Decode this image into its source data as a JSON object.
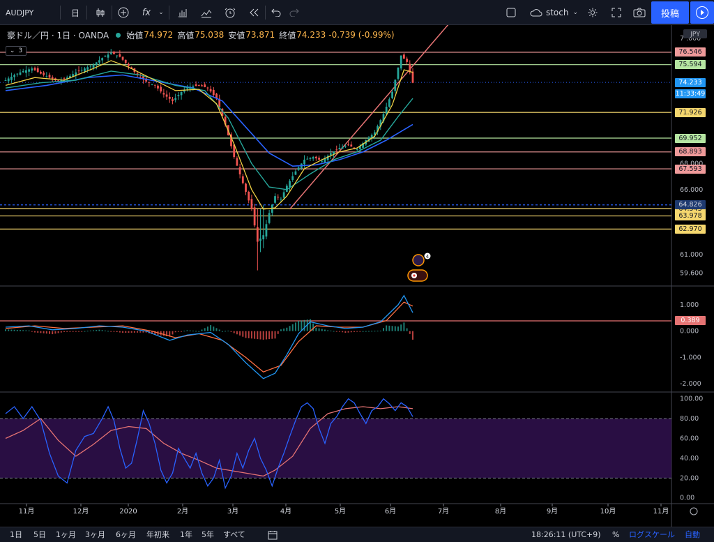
{
  "toolbar": {
    "symbol": "AUDJPY",
    "interval": "日",
    "indicator": "stoch",
    "publish": "投稿",
    "fx_label": "fx"
  },
  "legend": {
    "title": "豪ドル／円 · 1日 · OANDA",
    "open_label": "始値",
    "open": "74.972",
    "high_label": "高値",
    "high": "75.038",
    "low_label": "安値",
    "low": "73.871",
    "close_label": "終値",
    "close": "74.233",
    "change": "-0.739 (-0.99%)",
    "collapse_count": "3"
  },
  "currency": "JPY",
  "colors": {
    "sma_fast": "#f0d044",
    "sma_mid": "#26a69a",
    "sma_slow": "#2962ff",
    "resistance": "#ef9a9a",
    "support_yellow": "#f5d76e",
    "support_green": "#b5e5a1",
    "trendline": "#e57373",
    "stoch_k": "#2962ff",
    "stoch_d": "#e57373",
    "stoch_band": "#2e0f4a",
    "candle_up": "#26a69a",
    "candle_down": "#ef5350",
    "macd_line": "#2196f3",
    "signal_line": "#ff7043"
  },
  "chart_data": {
    "type": "candlestick",
    "ylim": [
      58.6,
      78.2
    ],
    "price_ticks": [
      "61.000",
      "59.600",
      "66.000",
      "68.000"
    ],
    "x_ticks": [
      "11月",
      "12月",
      "2020",
      "2月",
      "3月",
      "4月",
      "5月",
      "6月",
      "7月",
      "8月",
      "9月",
      "10月",
      "11月"
    ],
    "last_price": "74.233",
    "countdown": "11:33:49",
    "levels": [
      {
        "value": 76.546,
        "label": "76.546",
        "color": "#ef9a9a"
      },
      {
        "value": 75.594,
        "label": "75.594",
        "color": "#b5e5a1"
      },
      {
        "value": 71.926,
        "label": "71.926",
        "color": "#f5d76e"
      },
      {
        "value": 69.952,
        "label": "69.952",
        "color": "#b5e5a1"
      },
      {
        "value": 68.893,
        "label": "68.893",
        "color": "#ef9a9a"
      },
      {
        "value": 67.593,
        "label": "67.593",
        "color": "#ef9a9a"
      },
      {
        "value": 64.826,
        "label": "64.826",
        "color": "#2962ff",
        "dashed": true
      },
      {
        "value": 64.543,
        "label": "64.543",
        "color": "#f5d76e"
      },
      {
        "value": 63.978,
        "label": "63.978",
        "color": "#f5d76e"
      },
      {
        "value": 62.97,
        "label": "62.970",
        "color": "#f5d76e"
      }
    ],
    "price_path": [
      [
        0,
        74.4
      ],
      [
        3,
        74.8
      ],
      [
        6,
        75.1
      ],
      [
        9,
        75.3
      ],
      [
        12,
        74.9
      ],
      [
        15,
        74.6
      ],
      [
        18,
        74.3
      ],
      [
        21,
        74.6
      ],
      [
        24,
        75.0
      ],
      [
        27,
        75.3
      ],
      [
        30,
        75.6
      ],
      [
        33,
        76.1
      ],
      [
        36,
        76.5
      ],
      [
        39,
        76.2
      ],
      [
        42,
        75.5
      ],
      [
        45,
        74.8
      ],
      [
        48,
        74.3
      ],
      [
        51,
        74.0
      ],
      [
        54,
        73.3
      ],
      [
        57,
        72.8
      ],
      [
        60,
        73.5
      ],
      [
        63,
        73.9
      ],
      [
        66,
        74.0
      ],
      [
        69,
        73.8
      ],
      [
        72,
        73.0
      ],
      [
        75,
        71.0
      ],
      [
        78,
        68.5
      ],
      [
        81,
        66.5
      ],
      [
        84,
        64.5
      ],
      [
        86,
        62.0
      ],
      [
        88,
        62.5
      ],
      [
        90,
        64.2
      ],
      [
        92,
        65.5
      ],
      [
        94,
        65.3
      ],
      [
        96,
        66.3
      ],
      [
        99,
        67.4
      ],
      [
        102,
        68.3
      ],
      [
        105,
        68.5
      ],
      [
        108,
        68.2
      ],
      [
        111,
        68.8
      ],
      [
        114,
        69.2
      ],
      [
        117,
        69.4
      ],
      [
        120,
        69.1
      ],
      [
        123,
        69.8
      ],
      [
        126,
        70.4
      ],
      [
        129,
        71.8
      ],
      [
        132,
        73.5
      ],
      [
        135,
        76.3
      ],
      [
        137,
        75.8
      ],
      [
        139,
        74.2
      ]
    ],
    "sma_fast": [
      [
        0,
        74.0
      ],
      [
        10,
        74.6
      ],
      [
        20,
        74.4
      ],
      [
        30,
        75.3
      ],
      [
        36,
        75.9
      ],
      [
        42,
        75.4
      ],
      [
        50,
        74.5
      ],
      [
        58,
        73.6
      ],
      [
        66,
        73.7
      ],
      [
        72,
        72.6
      ],
      [
        78,
        69.5
      ],
      [
        84,
        66.0
      ],
      [
        88,
        64.5
      ],
      [
        92,
        64.6
      ],
      [
        96,
        65.5
      ],
      [
        102,
        67.6
      ],
      [
        108,
        68.3
      ],
      [
        114,
        68.9
      ],
      [
        120,
        69.2
      ],
      [
        126,
        70.1
      ],
      [
        132,
        72.5
      ],
      [
        136,
        75.2
      ],
      [
        139,
        75.0
      ]
    ],
    "sma_mid": [
      [
        0,
        73.8
      ],
      [
        12,
        74.2
      ],
      [
        24,
        74.4
      ],
      [
        36,
        75.1
      ],
      [
        46,
        74.8
      ],
      [
        58,
        74.0
      ],
      [
        68,
        73.6
      ],
      [
        76,
        71.5
      ],
      [
        84,
        68.0
      ],
      [
        90,
        66.2
      ],
      [
        96,
        66.0
      ],
      [
        104,
        67.2
      ],
      [
        112,
        68.3
      ],
      [
        120,
        68.9
      ],
      [
        128,
        69.8
      ],
      [
        134,
        71.6
      ],
      [
        139,
        73.0
      ]
    ],
    "sma_slow": [
      [
        0,
        73.6
      ],
      [
        14,
        74.0
      ],
      [
        28,
        74.6
      ],
      [
        40,
        74.8
      ],
      [
        52,
        74.3
      ],
      [
        64,
        73.8
      ],
      [
        74,
        72.8
      ],
      [
        82,
        70.8
      ],
      [
        90,
        68.8
      ],
      [
        98,
        67.8
      ],
      [
        106,
        67.9
      ],
      [
        114,
        68.3
      ],
      [
        122,
        68.9
      ],
      [
        130,
        69.8
      ],
      [
        139,
        71.0
      ]
    ],
    "trendline": {
      "from": [
        97,
        64.5
      ],
      "to": [
        160,
        81.0
      ]
    }
  },
  "macd": {
    "ticks": [
      "1.000",
      "0.000",
      "-1.000",
      "-2.000"
    ],
    "last_label": "0.389",
    "ylim": [
      -2.1,
      1.5
    ],
    "line": [
      [
        0,
        0.15
      ],
      [
        8,
        0.2
      ],
      [
        16,
        0.05
      ],
      [
        24,
        0.1
      ],
      [
        32,
        0.2
      ],
      [
        40,
        0.15
      ],
      [
        48,
        0.0
      ],
      [
        56,
        -0.35
      ],
      [
        62,
        -0.15
      ],
      [
        70,
        -0.05
      ],
      [
        76,
        -0.5
      ],
      [
        82,
        -1.2
      ],
      [
        88,
        -1.8
      ],
      [
        92,
        -1.6
      ],
      [
        96,
        -0.9
      ],
      [
        100,
        -0.1
      ],
      [
        104,
        0.35
      ],
      [
        110,
        0.2
      ],
      [
        116,
        0.1
      ],
      [
        122,
        0.15
      ],
      [
        128,
        0.35
      ],
      [
        134,
        1.0
      ],
      [
        136,
        1.35
      ],
      [
        139,
        0.7
      ]
    ],
    "signal": [
      [
        0,
        0.1
      ],
      [
        10,
        0.2
      ],
      [
        20,
        0.1
      ],
      [
        30,
        0.15
      ],
      [
        40,
        0.2
      ],
      [
        50,
        0.0
      ],
      [
        58,
        -0.25
      ],
      [
        66,
        -0.1
      ],
      [
        74,
        -0.35
      ],
      [
        82,
        -1.0
      ],
      [
        88,
        -1.55
      ],
      [
        94,
        -1.3
      ],
      [
        100,
        -0.4
      ],
      [
        106,
        0.2
      ],
      [
        114,
        0.15
      ],
      [
        122,
        0.15
      ],
      [
        130,
        0.4
      ],
      [
        136,
        1.1
      ],
      [
        139,
        0.95
      ]
    ]
  },
  "stoch": {
    "ticks": [
      "100.00",
      "80.00",
      "60.00",
      "40.00",
      "20.00",
      "0.00"
    ],
    "band": [
      20,
      80
    ],
    "ylim": [
      -3,
      104
    ],
    "k": [
      [
        0,
        85
      ],
      [
        3,
        92
      ],
      [
        6,
        80
      ],
      [
        9,
        92
      ],
      [
        12,
        78
      ],
      [
        15,
        45
      ],
      [
        18,
        22
      ],
      [
        21,
        15
      ],
      [
        24,
        48
      ],
      [
        27,
        62
      ],
      [
        30,
        65
      ],
      [
        33,
        80
      ],
      [
        35,
        92
      ],
      [
        37,
        78
      ],
      [
        39,
        50
      ],
      [
        41,
        30
      ],
      [
        43,
        35
      ],
      [
        45,
        60
      ],
      [
        47,
        88
      ],
      [
        49,
        75
      ],
      [
        51,
        55
      ],
      [
        53,
        28
      ],
      [
        55,
        15
      ],
      [
        57,
        25
      ],
      [
        59,
        50
      ],
      [
        61,
        40
      ],
      [
        63,
        30
      ],
      [
        65,
        45
      ],
      [
        67,
        25
      ],
      [
        69,
        12
      ],
      [
        71,
        20
      ],
      [
        73,
        38
      ],
      [
        75,
        10
      ],
      [
        77,
        22
      ],
      [
        79,
        45
      ],
      [
        81,
        30
      ],
      [
        83,
        48
      ],
      [
        85,
        60
      ],
      [
        87,
        40
      ],
      [
        89,
        28
      ],
      [
        91,
        12
      ],
      [
        93,
        30
      ],
      [
        95,
        45
      ],
      [
        97,
        62
      ],
      [
        99,
        78
      ],
      [
        101,
        92
      ],
      [
        103,
        96
      ],
      [
        105,
        90
      ],
      [
        107,
        70
      ],
      [
        109,
        55
      ],
      [
        111,
        75
      ],
      [
        113,
        82
      ],
      [
        115,
        92
      ],
      [
        117,
        100
      ],
      [
        119,
        96
      ],
      [
        121,
        85
      ],
      [
        123,
        75
      ],
      [
        125,
        88
      ],
      [
        127,
        92
      ],
      [
        129,
        100
      ],
      [
        131,
        95
      ],
      [
        133,
        88
      ],
      [
        135,
        96
      ],
      [
        137,
        92
      ],
      [
        139,
        82
      ]
    ],
    "d": [
      [
        0,
        60
      ],
      [
        6,
        68
      ],
      [
        12,
        80
      ],
      [
        18,
        58
      ],
      [
        24,
        42
      ],
      [
        30,
        54
      ],
      [
        36,
        68
      ],
      [
        42,
        72
      ],
      [
        48,
        70
      ],
      [
        54,
        55
      ],
      [
        60,
        45
      ],
      [
        66,
        38
      ],
      [
        72,
        30
      ],
      [
        78,
        27
      ],
      [
        84,
        24
      ],
      [
        88,
        22
      ],
      [
        92,
        28
      ],
      [
        98,
        42
      ],
      [
        104,
        70
      ],
      [
        110,
        85
      ],
      [
        116,
        90
      ],
      [
        122,
        92
      ],
      [
        128,
        90
      ],
      [
        134,
        92
      ],
      [
        139,
        90
      ]
    ]
  }
}
